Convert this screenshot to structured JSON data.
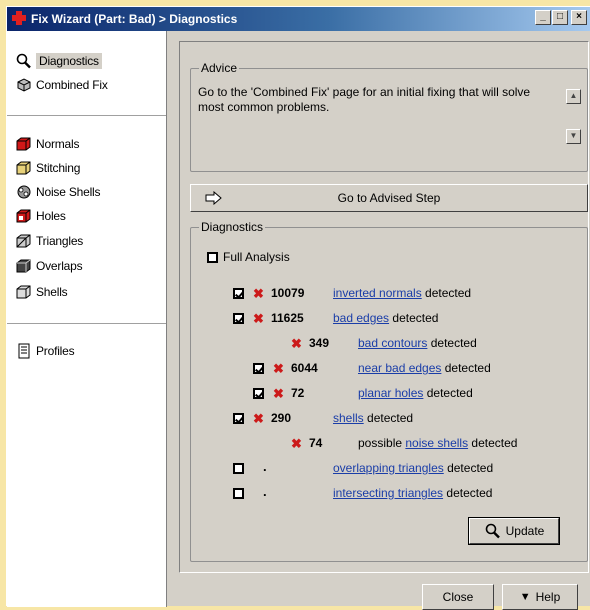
{
  "window": {
    "title": "Fix Wizard (Part: Bad) > Diagnostics",
    "controls": {
      "minimize": "_",
      "maximize": "□",
      "close": "×"
    }
  },
  "sidebar": {
    "top_items": [
      {
        "label": "Diagnostics",
        "icon": "magnifier-icon",
        "active": true
      },
      {
        "label": "Combined Fix",
        "icon": "combined-fix-icon",
        "active": false
      }
    ],
    "tool_items": [
      {
        "label": "Normals",
        "icon": "normals-cube-icon"
      },
      {
        "label": "Stitching",
        "icon": "stitching-cube-icon"
      },
      {
        "label": "Noise Shells",
        "icon": "noise-shells-icon"
      },
      {
        "label": "Holes",
        "icon": "holes-cube-icon"
      },
      {
        "label": "Triangles",
        "icon": "triangles-cube-icon"
      },
      {
        "label": "Overlaps",
        "icon": "overlaps-cube-icon"
      },
      {
        "label": "Shells",
        "icon": "shells-cube-icon"
      }
    ],
    "bottom_items": [
      {
        "label": "Profiles",
        "icon": "profiles-icon"
      }
    ]
  },
  "advice": {
    "group_label": "Advice",
    "text": "Go to the 'Combined Fix' page for an initial fixing that will solve most common problems."
  },
  "advised_step_button": "Go to Advised Step",
  "diagnostics": {
    "group_label": "Diagnostics",
    "full_analysis_label": "Full Analysis",
    "full_analysis_checked": false,
    "rows": [
      {
        "checked": true,
        "count": "10079",
        "prefix": "",
        "link": "inverted normals",
        "suffix": " detected"
      },
      {
        "checked": true,
        "count": "11625",
        "prefix": "",
        "link": "bad edges",
        "suffix": " detected"
      },
      {
        "checked": null,
        "count": "349",
        "prefix": "",
        "link": "bad contours",
        "suffix": " detected"
      },
      {
        "checked": true,
        "count": "6044",
        "prefix": "",
        "link": "near bad edges",
        "suffix": " detected"
      },
      {
        "checked": true,
        "count": "72",
        "prefix": "",
        "link": "planar holes",
        "suffix": " detected"
      },
      {
        "checked": true,
        "count": "290",
        "prefix": "",
        "link": "shells",
        "suffix": " detected"
      },
      {
        "checked": null,
        "count": "74",
        "prefix": "possible ",
        "link": "noise shells",
        "suffix": " detected"
      },
      {
        "checked": false,
        "count": ".",
        "prefix": "",
        "link": "overlapping triangles",
        "suffix": " detected"
      },
      {
        "checked": false,
        "count": ".",
        "prefix": "",
        "link": "intersecting triangles",
        "suffix": " detected"
      }
    ],
    "update_button": "Update"
  },
  "footer": {
    "close_button": "Close",
    "help_button": "Help"
  },
  "colors": {
    "background": "#f7e6a6",
    "dialog": "#d4d0c8",
    "title_gradient_start": "#0a246a",
    "link": "#1a3da8",
    "error_mark": "#cc1a1a"
  }
}
